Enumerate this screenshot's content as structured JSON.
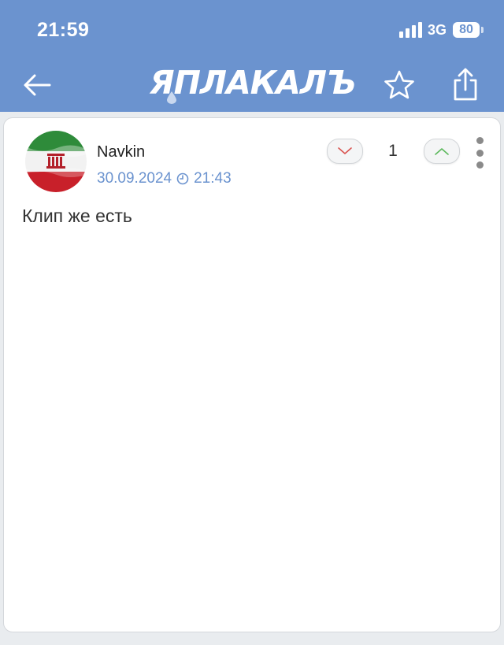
{
  "status_bar": {
    "time": "21:59",
    "network": "3G",
    "battery": "80",
    "signal_bars": 4
  },
  "nav": {
    "logo_text": "ЯПЛАКАЛЪ",
    "back_icon": "arrow-left-icon",
    "favorite_icon": "star-icon",
    "share_icon": "share-icon"
  },
  "comment": {
    "author": "Navkin",
    "date": "30.09.2024",
    "time": "21:43",
    "score": "1",
    "text": "Клип же есть",
    "avatar": "flag-avatar"
  },
  "colors": {
    "header_bg": "#6b93cf",
    "accent": "#6b93cf",
    "downvote": "#d9534f",
    "upvote": "#5cb85c"
  }
}
